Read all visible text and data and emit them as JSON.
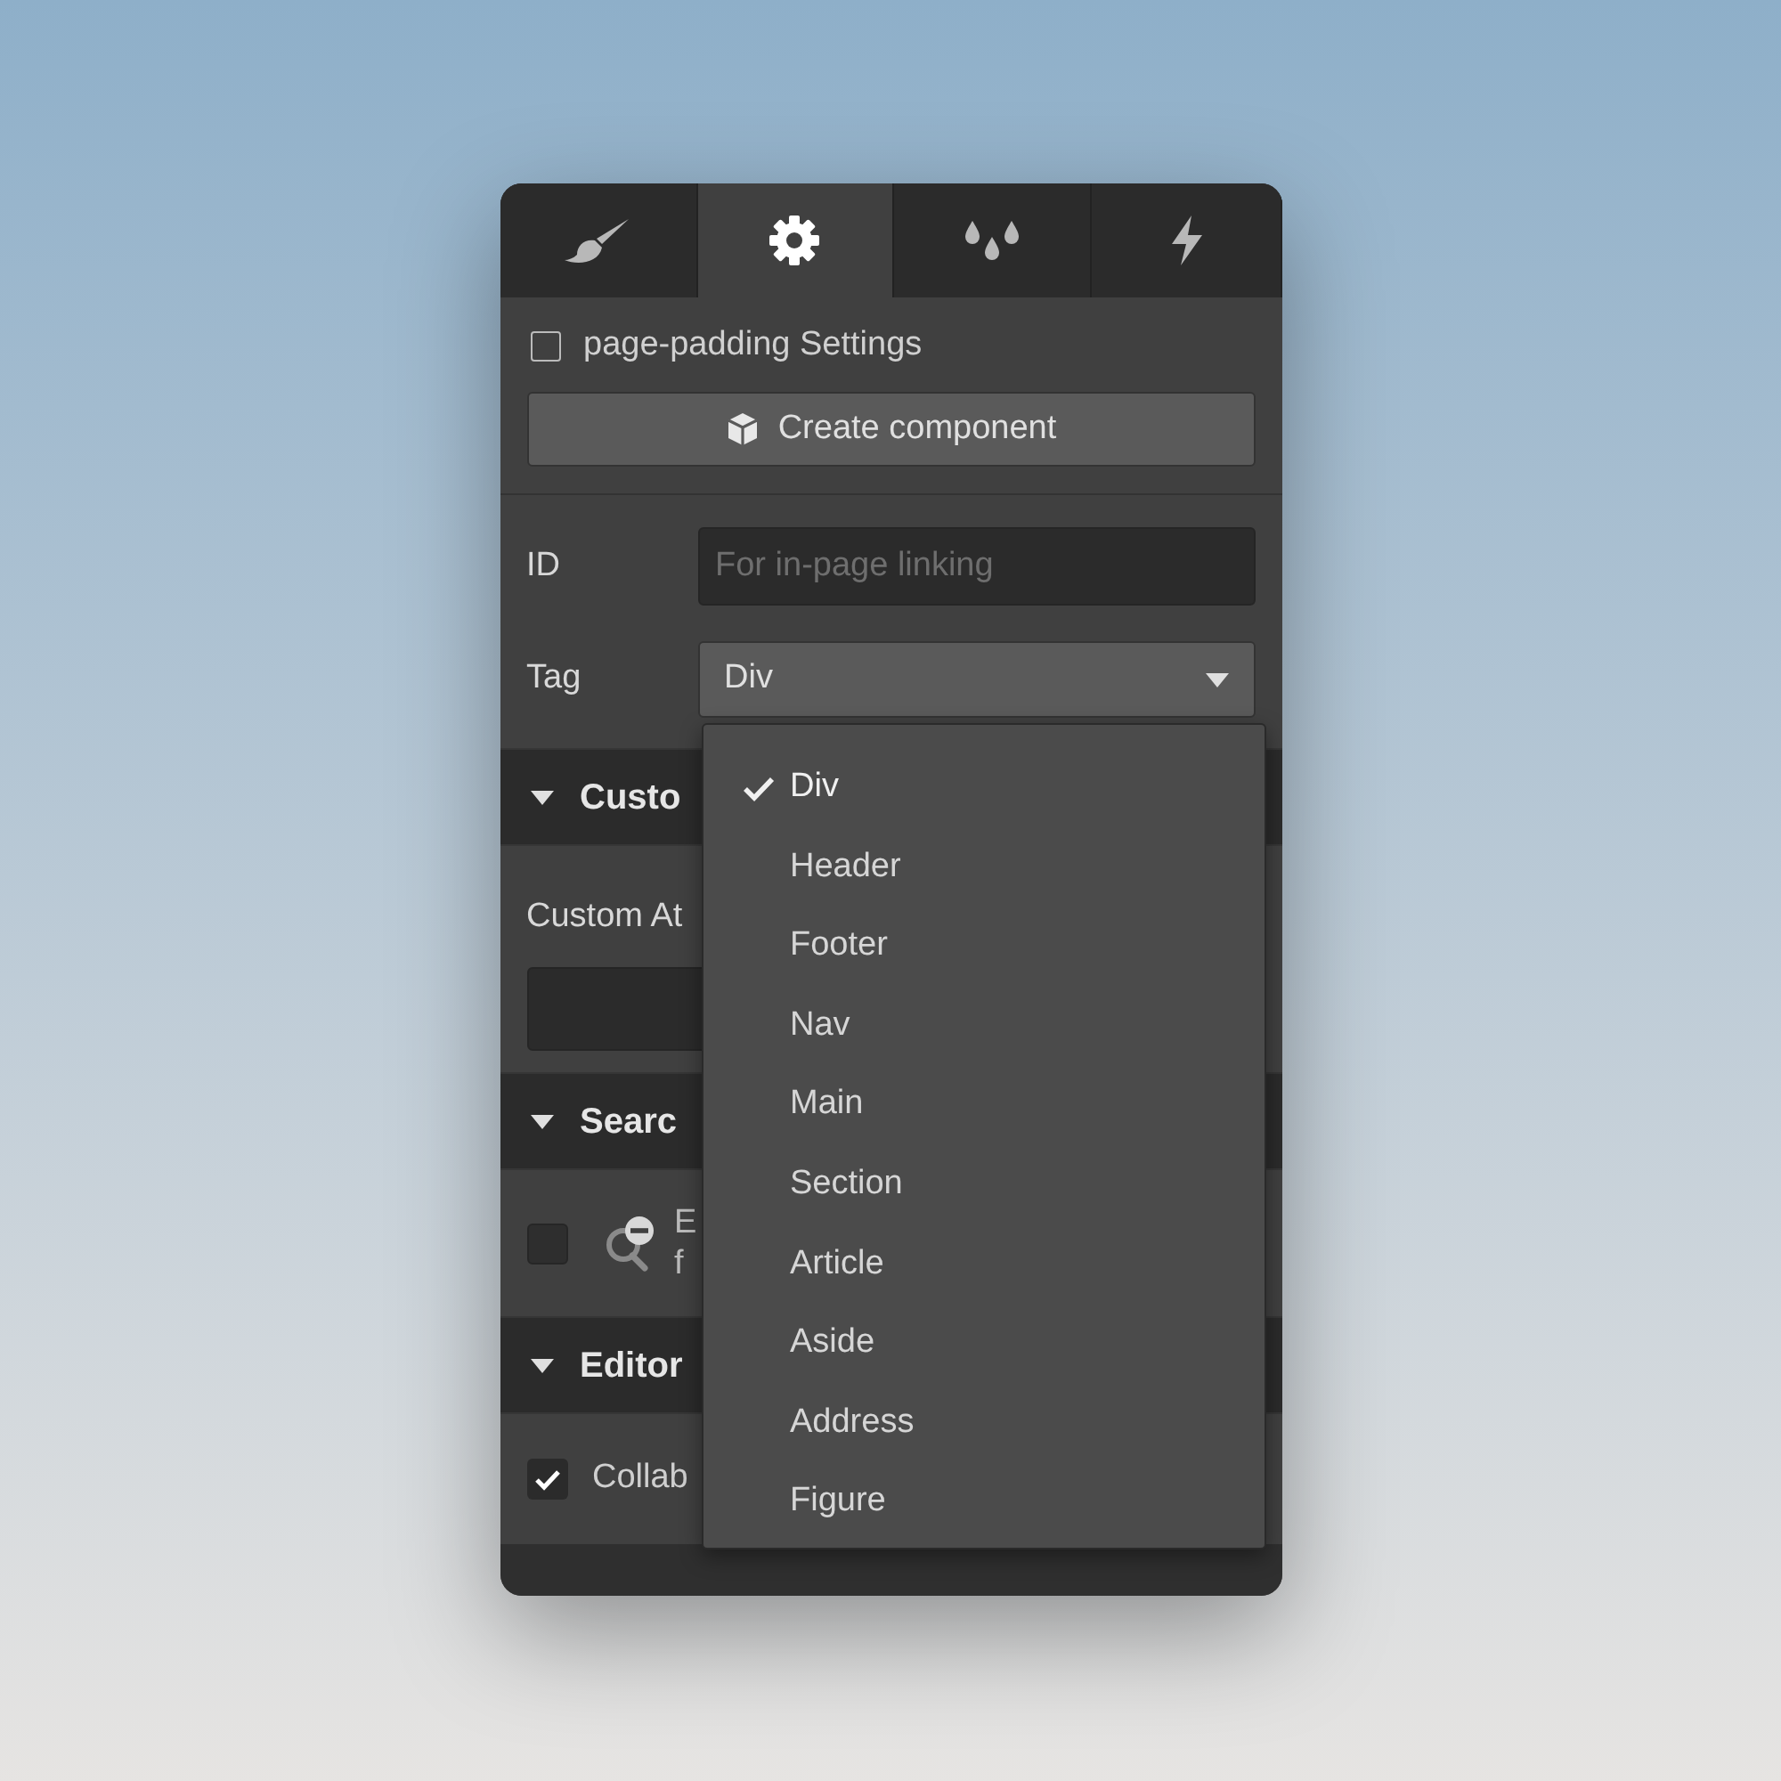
{
  "tabs": [
    {
      "kind": "brush",
      "selected": false
    },
    {
      "kind": "gear",
      "selected": true
    },
    {
      "kind": "drops",
      "selected": false
    },
    {
      "kind": "bolt",
      "selected": false
    }
  ],
  "settings_toggle": {
    "label": "page-padding Settings",
    "checked": false
  },
  "create_button": "Create component",
  "id_field": {
    "label": "ID",
    "placeholder": "For in-page linking"
  },
  "tag_field": {
    "label": "Tag",
    "value": "Div"
  },
  "sections": [
    {
      "kind": "attributes",
      "title": "Custo",
      "expanded": true,
      "label": "Custom At"
    },
    {
      "kind": "search",
      "title": "Searc",
      "expanded": true,
      "checked": false,
      "label_lines": [
        "E",
        "f"
      ]
    },
    {
      "kind": "editor",
      "title": "Editor",
      "expanded": true,
      "checked": true,
      "label": "Collab"
    }
  ],
  "tag_dropdown": [
    {
      "label": "Div",
      "selected": true
    },
    {
      "label": "Header",
      "selected": false
    },
    {
      "label": "Footer",
      "selected": false
    },
    {
      "label": "Nav",
      "selected": false
    },
    {
      "label": "Main",
      "selected": false
    },
    {
      "label": "Section",
      "selected": false
    },
    {
      "label": "Article",
      "selected": false
    },
    {
      "label": "Aside",
      "selected": false
    },
    {
      "label": "Address",
      "selected": false
    },
    {
      "label": "Figure",
      "selected": false
    }
  ]
}
